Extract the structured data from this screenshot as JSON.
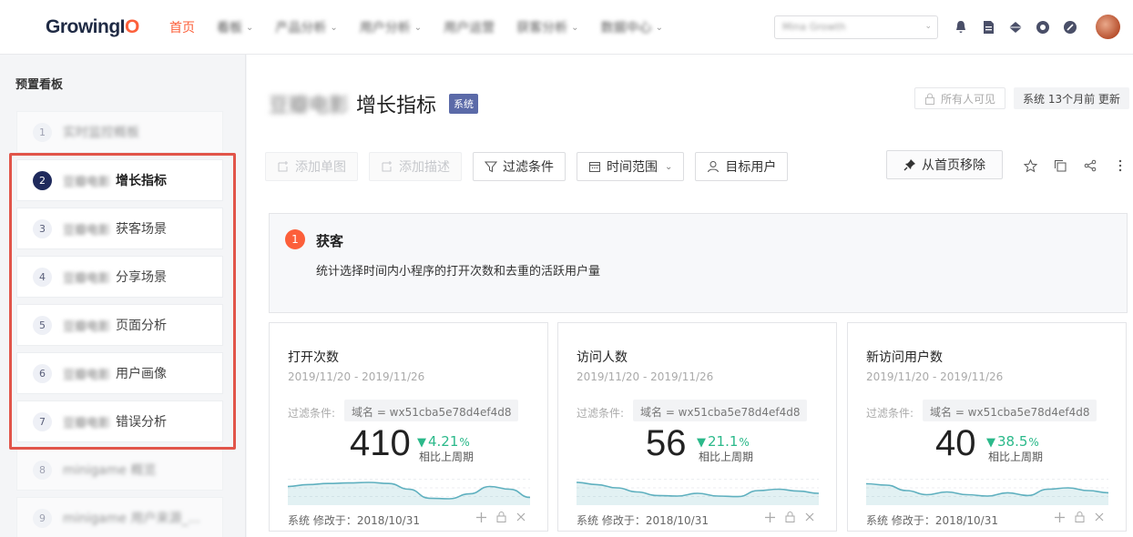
{
  "nav": {
    "logo_main": "GrowingI",
    "logo_accent": "O",
    "items": [
      {
        "label": "首页",
        "active": true,
        "dropdown": false
      },
      {
        "label": "看板",
        "active": false,
        "dropdown": true
      },
      {
        "label": "产品分析",
        "active": false,
        "dropdown": true
      },
      {
        "label": "用户分析",
        "active": false,
        "dropdown": true
      },
      {
        "label": "用户运营",
        "active": false,
        "dropdown": false
      },
      {
        "label": "获客分析",
        "active": false,
        "dropdown": true
      },
      {
        "label": "数据中心",
        "active": false,
        "dropdown": true
      }
    ],
    "project_select": "Mina Growth",
    "icons": [
      "bell-icon",
      "document-icon",
      "diamond-icon",
      "help-icon",
      "settings-icon"
    ]
  },
  "sidebar": {
    "title": "预置看板",
    "items": [
      {
        "num": "1",
        "prefix": "",
        "label": "实时监控概板",
        "state": "dim"
      },
      {
        "num": "2",
        "prefix": "豆瓣电影",
        "label": "增长指标",
        "state": "active"
      },
      {
        "num": "3",
        "prefix": "豆瓣电影",
        "label": "获客场景",
        "state": "normal"
      },
      {
        "num": "4",
        "prefix": "豆瓣电影",
        "label": "分享场景",
        "state": "normal"
      },
      {
        "num": "5",
        "prefix": "豆瓣电影",
        "label": "页面分析",
        "state": "normal"
      },
      {
        "num": "6",
        "prefix": "豆瓣电影",
        "label": "用户画像",
        "state": "normal"
      },
      {
        "num": "7",
        "prefix": "豆瓣电影",
        "label": "错误分析",
        "state": "normal"
      },
      {
        "num": "8",
        "prefix": "",
        "label": "minigame 概览",
        "state": "dim"
      },
      {
        "num": "9",
        "prefix": "",
        "label": "minigame 用户来源_...",
        "state": "dim"
      }
    ]
  },
  "page": {
    "title_prefix": "豆瓣电影",
    "title": "增长指标",
    "badge": "系统",
    "visibility": "所有人可见",
    "updated": "系统 13个月前 更新"
  },
  "toolbar": {
    "add_chart": "添加单图",
    "add_desc": "添加描述",
    "filter": "过滤条件",
    "time_range": "时间范围",
    "target_user": "目标用户",
    "remove_home": "从首页移除"
  },
  "section": {
    "num": "1",
    "title": "获客",
    "desc": "统计选择时间内小程序的打开次数和去重的活跃用户量"
  },
  "cards": [
    {
      "title": "打开次数",
      "date": "2019/11/20 - 2019/11/26",
      "filter_label": "过滤条件:",
      "filter": "域名 = wx51cba5e78d4ef4d8",
      "value": "410",
      "change": "4.21",
      "change_unit": "%",
      "compare": "相比上周期",
      "footer": "系统  修改于：2018/10/31",
      "sparkline": [
        0.55,
        0.62,
        0.66,
        0.68,
        0.7,
        0.66,
        0.45,
        0.12,
        0.1,
        0.28,
        0.55,
        0.45,
        0.15
      ]
    },
    {
      "title": "访问人数",
      "date": "2019/11/20 - 2019/11/26",
      "filter_label": "过滤条件:",
      "filter": "域名 = wx51cba5e78d4ef4d8",
      "value": "56",
      "change": "21.1",
      "change_unit": "%",
      "compare": "相比上周期",
      "footer": "系统  修改于：2018/10/31",
      "sparkline": [
        0.7,
        0.62,
        0.5,
        0.35,
        0.22,
        0.2,
        0.3,
        0.2,
        0.18,
        0.4,
        0.45,
        0.38,
        0.3
      ]
    },
    {
      "title": "新访问用户数",
      "date": "2019/11/20 - 2019/11/26",
      "filter_label": "过滤条件:",
      "filter": "域名 = wx51cba5e78d4ef4d8",
      "value": "40",
      "change": "38.5",
      "change_unit": "%",
      "compare": "相比上周期",
      "footer": "系统  修改于：2018/10/31",
      "sparkline": [
        0.65,
        0.6,
        0.4,
        0.25,
        0.35,
        0.25,
        0.2,
        0.32,
        0.22,
        0.45,
        0.5,
        0.4,
        0.32
      ]
    }
  ],
  "colors": {
    "accent": "#fc5f3a",
    "badge": "#5b6aa8",
    "positive": "#2bb98a",
    "spark_line": "#5fb0bf",
    "highlight": "#e1554a"
  }
}
